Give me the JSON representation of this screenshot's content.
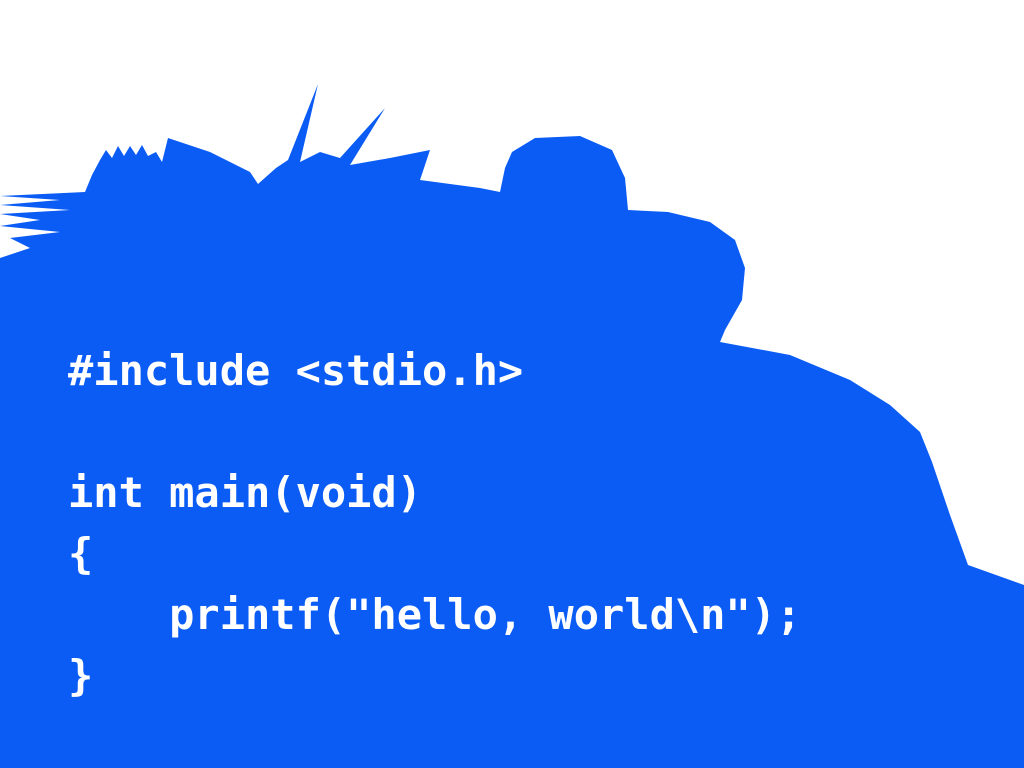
{
  "colors": {
    "background": "#ffffff",
    "brush": "#0a5cf5",
    "code_text": "#ffffff"
  },
  "code": {
    "language": "c",
    "lines": [
      "#include <stdio.h>",
      "",
      "int main(void)",
      "{",
      "    printf(\"hello, world\\n\");",
      "}"
    ]
  }
}
